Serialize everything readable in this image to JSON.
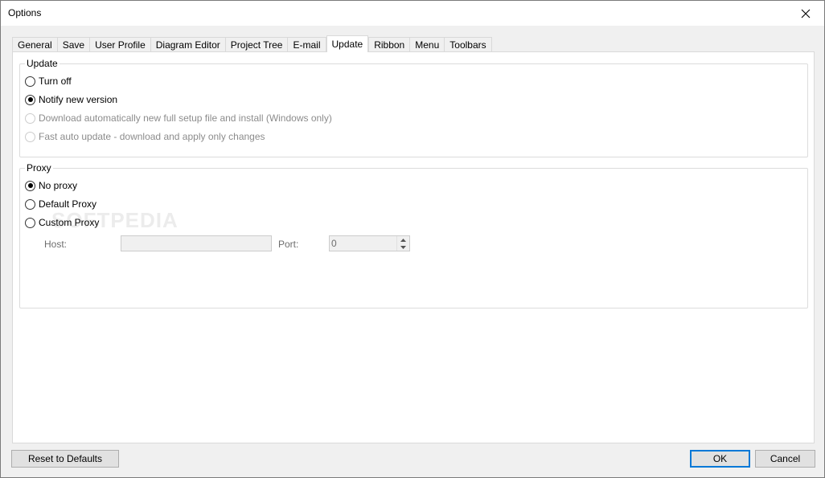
{
  "window": {
    "title": "Options"
  },
  "tabs": [
    {
      "label": "General",
      "active": false
    },
    {
      "label": "Save",
      "active": false
    },
    {
      "label": "User Profile",
      "active": false
    },
    {
      "label": "Diagram Editor",
      "active": false
    },
    {
      "label": "Project Tree",
      "active": false
    },
    {
      "label": "E-mail",
      "active": false
    },
    {
      "label": "Update",
      "active": true
    },
    {
      "label": "Ribbon",
      "active": false
    },
    {
      "label": "Menu",
      "active": false
    },
    {
      "label": "Toolbars",
      "active": false
    }
  ],
  "update_group": {
    "legend": "Update",
    "options": [
      {
        "label": "Turn off",
        "checked": false,
        "disabled": false
      },
      {
        "label": "Notify new version",
        "checked": true,
        "disabled": false
      },
      {
        "label": "Download automatically new full setup file and install (Windows only)",
        "checked": false,
        "disabled": true
      },
      {
        "label": "Fast auto update - download and apply only changes",
        "checked": false,
        "disabled": true
      }
    ]
  },
  "proxy_group": {
    "legend": "Proxy",
    "options": [
      {
        "label": "No proxy",
        "checked": true
      },
      {
        "label": "Default Proxy",
        "checked": false
      },
      {
        "label": "Custom Proxy",
        "checked": false
      }
    ],
    "host_label": "Host:",
    "host_value": "",
    "port_label": "Port:",
    "port_value": "0"
  },
  "watermark": "SOFTPEDIA",
  "buttons": {
    "reset": "Reset to Defaults",
    "ok": "OK",
    "cancel": "Cancel"
  }
}
